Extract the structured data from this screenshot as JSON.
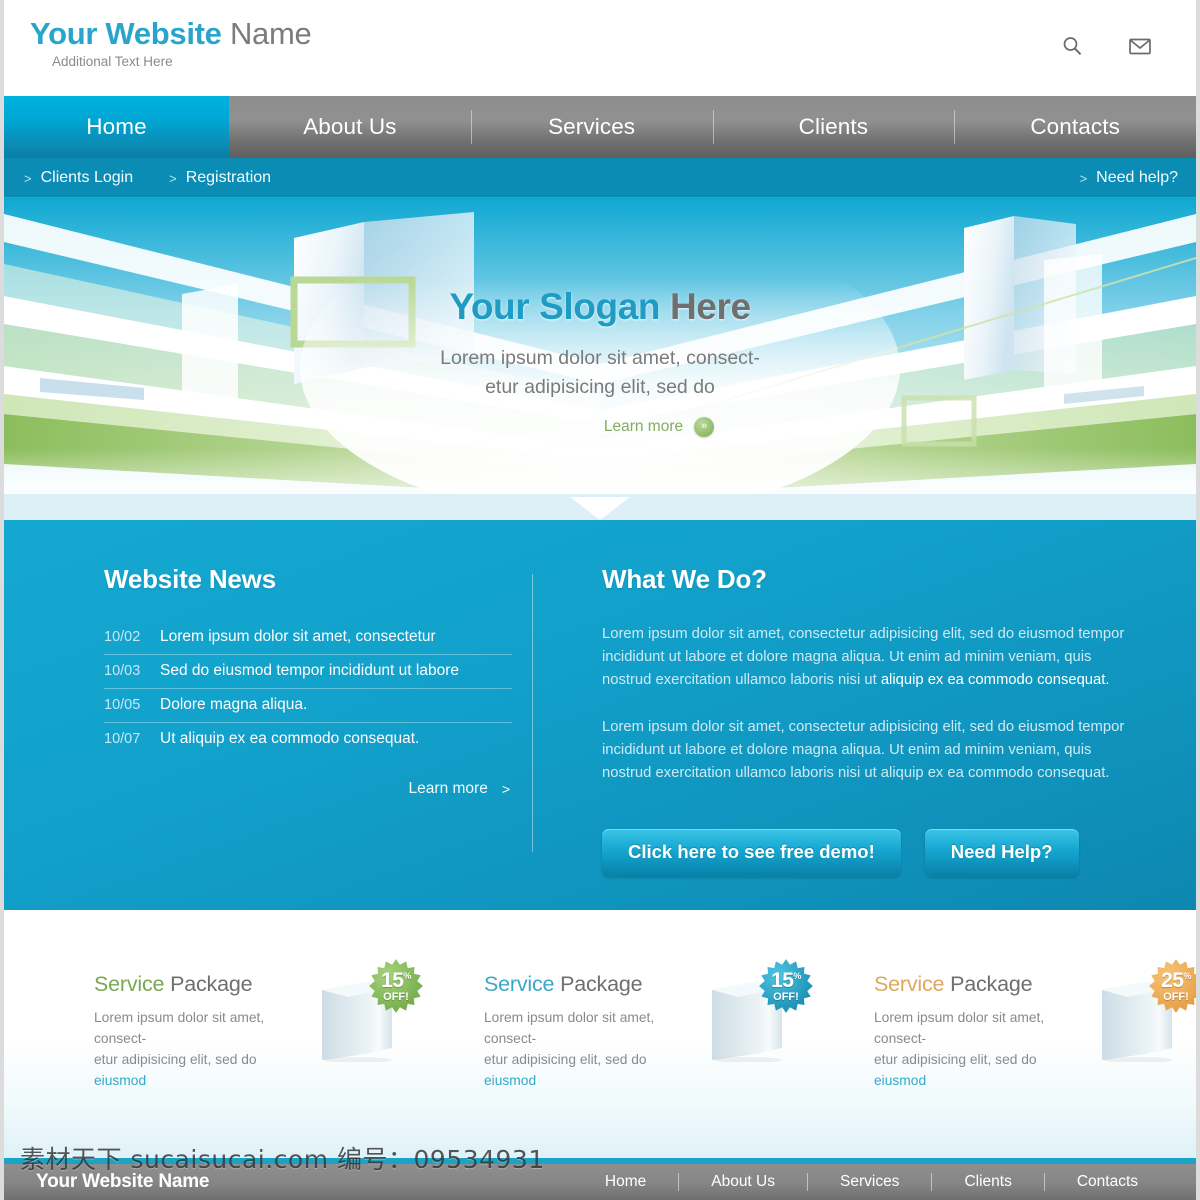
{
  "brand": {
    "title_part1": "Your Website",
    "title_part2": " Name",
    "subtitle": "Additional Text Here",
    "accent_color": "#29a5cc",
    "gray_color": "#7c7c7c"
  },
  "header": {
    "icons": [
      {
        "name": "search-icon",
        "label": "Search"
      },
      {
        "name": "mail-icon",
        "label": "Mail"
      }
    ]
  },
  "nav": {
    "items": [
      {
        "label": "Home",
        "active": true
      },
      {
        "label": "About Us",
        "active": false
      },
      {
        "label": "Services",
        "active": false
      },
      {
        "label": "Clients",
        "active": false
      },
      {
        "label": "Contacts",
        "active": false
      }
    ],
    "active_color": "#0b8cb4"
  },
  "subnav": {
    "chevron": ">",
    "left_links": [
      {
        "label": "Clients Login"
      },
      {
        "label": "Registration"
      }
    ],
    "right_link": {
      "label": "Need help?"
    }
  },
  "hero": {
    "slogan_part1": "Your Slogan",
    "slogan_part2": " Here",
    "subtitle": "Lorem ipsum dolor sit amet, consect-\netur adipisicing elit, sed do",
    "learn_more": "Learn more",
    "arrow_glyph": "»",
    "green_color": "#86ab62"
  },
  "news": {
    "title": "Website News",
    "items": [
      {
        "date": "10/02",
        "text": "Lorem ipsum dolor sit amet, consectetur"
      },
      {
        "date": "10/03",
        "text": "Sed do eiusmod tempor incididunt ut labore"
      },
      {
        "date": "10/05",
        "text": "Dolore magna aliqua."
      },
      {
        "date": "10/07",
        "text": "Ut aliquip ex ea commodo consequat."
      }
    ],
    "learn_more": "Learn more",
    "chevron": ">"
  },
  "what_we_do": {
    "title": "What  We Do?",
    "paragraph1_plain": "Lorem ipsum dolor sit amet, consectetur adipisicing elit, sed do eiusmod tempor incididunt ut labore et dolore magna aliqua. Ut enim ad minim veniam, quis nostrud exercitation ullamco laboris nisi ut ",
    "paragraph1_highlight": "aliquip ex ea commodo consequat.",
    "paragraph2": "Lorem ipsum dolor sit amet, consectetur adipisicing elit, sed do eiusmod tempor incididunt ut labore et dolore magna aliqua. Ut enim ad minim veniam, quis nostrud exercitation ullamco laboris nisi ut aliquip ex ea commodo consequat.",
    "buttons": [
      {
        "label": "Click here to see free demo!"
      },
      {
        "label": "Need Help?"
      }
    ]
  },
  "services": {
    "packages": [
      {
        "title_part1": "Service",
        "title_part2": " Package",
        "title_color": "#7aa850",
        "desc_plain": "Lorem ipsum dolor sit amet, consect-\netur adipisicing elit, sed do ",
        "desc_link": "eiusmod",
        "badge_number": "15",
        "badge_percent": "%",
        "badge_off": "OFF!",
        "badge_color_light": "#a7d27e",
        "badge_color_dark": "#6fa844"
      },
      {
        "title_part1": "Service",
        "title_part2": " Package",
        "title_color": "#3aa8c8",
        "desc_plain": "Lorem ipsum dolor sit amet, consect-\netur adipisicing elit, sed do ",
        "desc_link": "eiusmod",
        "badge_number": "15",
        "badge_percent": "%",
        "badge_off": "OFF!",
        "badge_color_light": "#4fc4e2",
        "badge_color_dark": "#1389ae"
      },
      {
        "title_part1": "Service",
        "title_part2": " Package",
        "title_color": "#e0a85c",
        "desc_plain": "Lorem ipsum dolor sit amet, consect-\netur adipisicing elit, sed do ",
        "desc_link": "eiusmod",
        "badge_number": "25",
        "badge_percent": "%",
        "badge_off": "OFF!",
        "badge_color_light": "#f7c479",
        "badge_color_dark": "#e39a3e"
      }
    ]
  },
  "footer": {
    "brand": "Your Website Name",
    "links": [
      {
        "label": "Home"
      },
      {
        "label": "About Us"
      },
      {
        "label": "Services"
      },
      {
        "label": "Clients"
      },
      {
        "label": "Contacts"
      }
    ],
    "top_border_color": "#1ba3c6"
  },
  "watermark": {
    "text": "素材天下 sucaisucai.com  编号：09534931"
  }
}
